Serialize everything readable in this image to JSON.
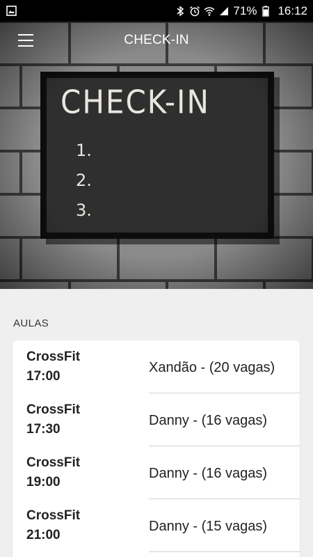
{
  "status_bar": {
    "battery_percent": "71%",
    "time": "16:12",
    "icons": [
      "image-icon",
      "bluetooth-icon",
      "alarm-icon",
      "wifi-icon",
      "signal-icon",
      "battery-icon"
    ]
  },
  "app_bar": {
    "title": "CHECK-IN",
    "menu_icon": "hamburger-menu-icon"
  },
  "hero": {
    "chalkboard_title": "CHECK-IN",
    "chalkboard_items": [
      "1.",
      "2.",
      "3."
    ]
  },
  "section": {
    "label": "AULAS"
  },
  "classes": [
    {
      "name": "CrossFit",
      "time": "17:00",
      "info": "Xandão - (20 vagas)"
    },
    {
      "name": "CrossFit",
      "time": "17:30",
      "info": "Danny - (16 vagas)"
    },
    {
      "name": "CrossFit",
      "time": "19:00",
      "info": "Danny - (16 vagas)"
    },
    {
      "name": "CrossFit",
      "time": "21:00",
      "info": "Danny - (15 vagas)"
    }
  ],
  "colors": {
    "status_bar_bg": "#000000",
    "page_bg": "#efefef",
    "card_bg": "#ffffff",
    "divider": "#cfcfcf",
    "chalk": "#e8e6df"
  }
}
